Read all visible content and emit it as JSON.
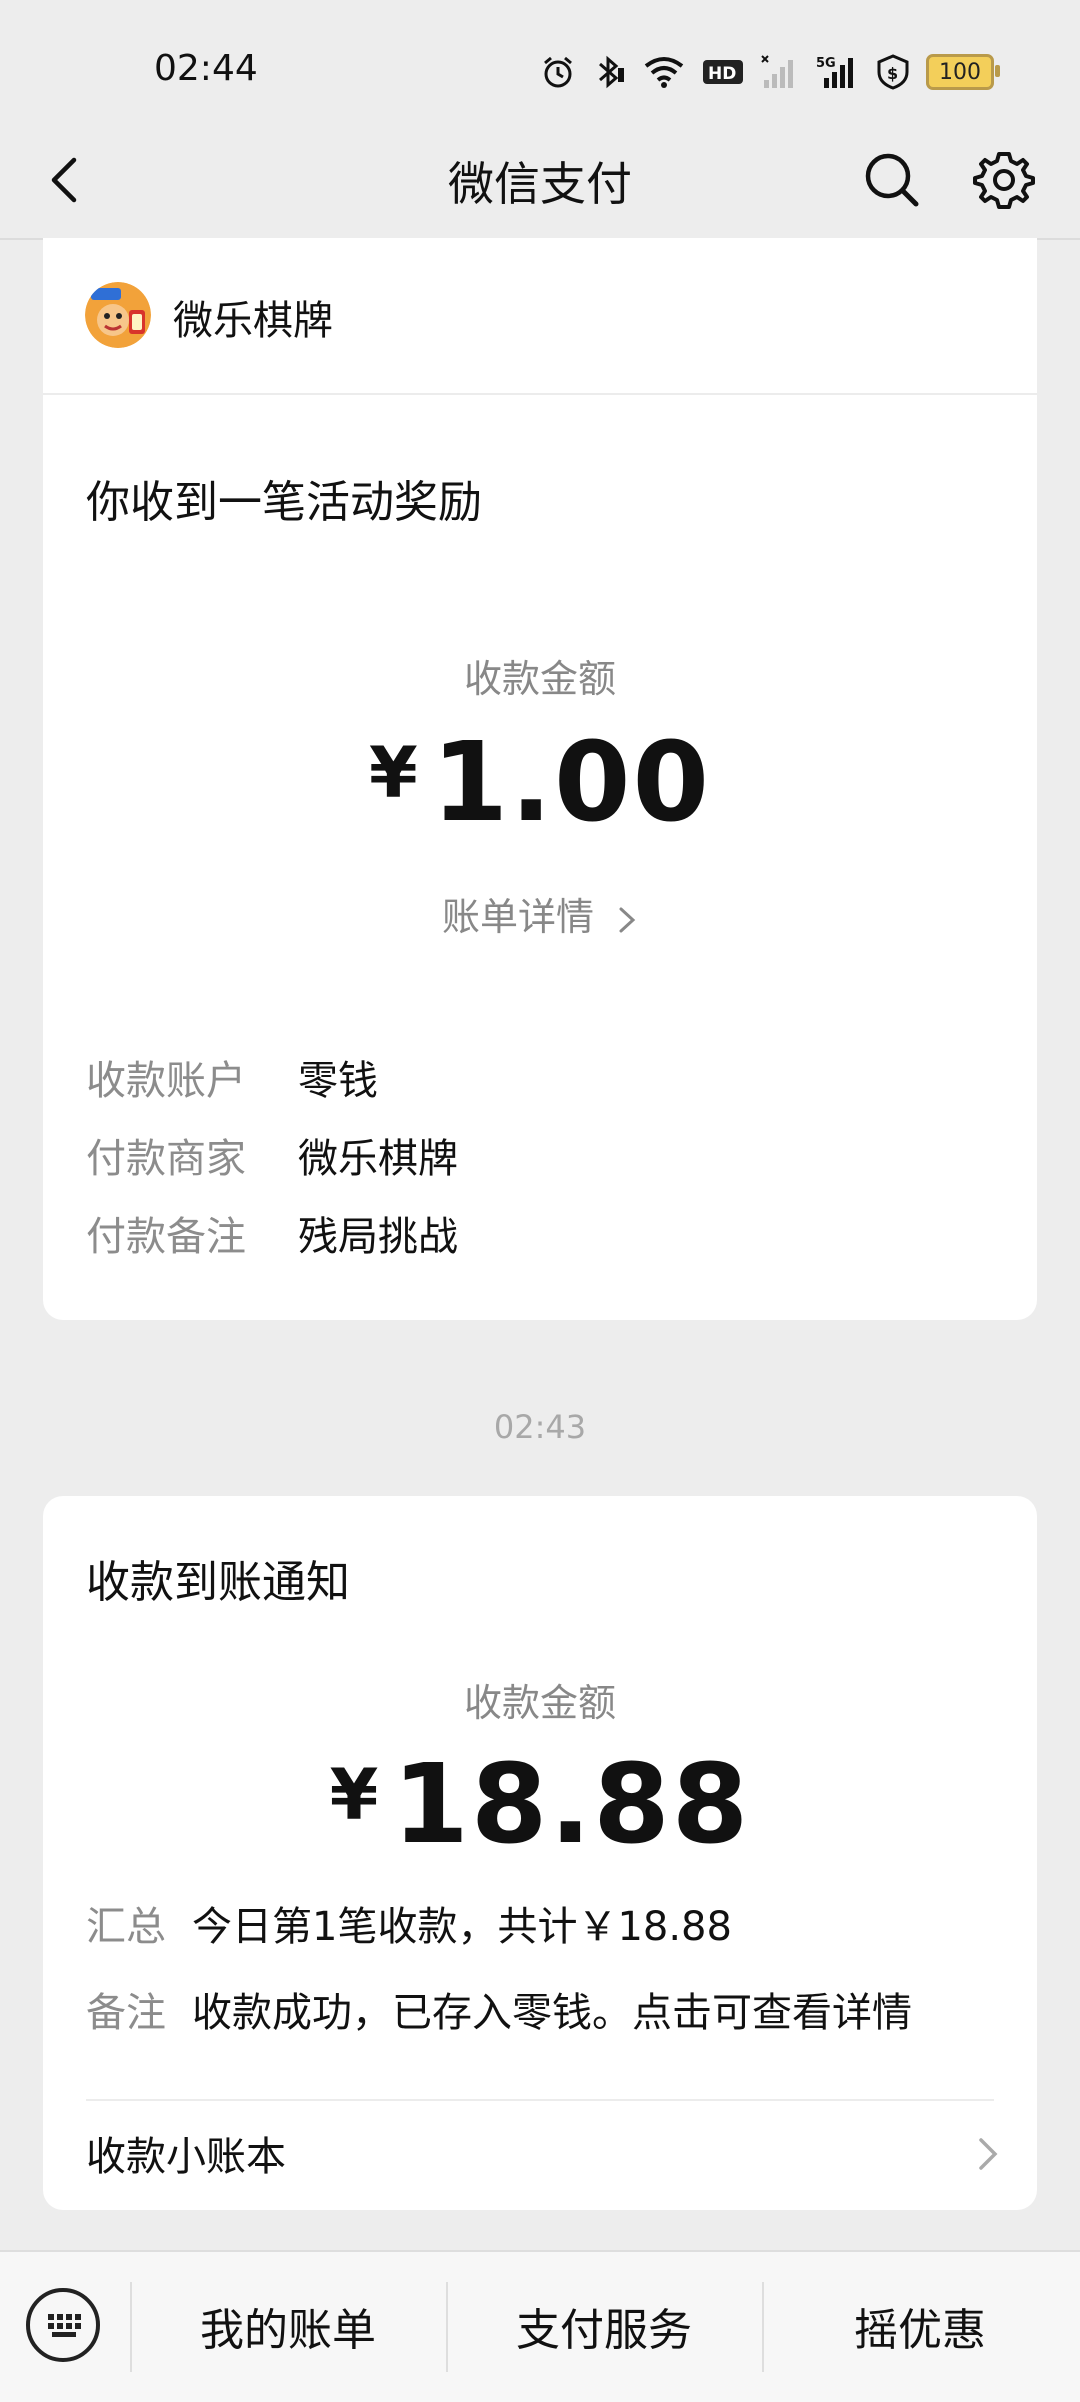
{
  "status_bar": {
    "time": "02:44",
    "network": "5G",
    "hd": "HD",
    "battery": "100"
  },
  "nav": {
    "title": "微信支付"
  },
  "card1": {
    "merchant_name": "微乐棋牌",
    "headline": "你收到一笔活动奖励",
    "amount_label": "收款金额",
    "currency": "¥",
    "amount": "1.00",
    "bill_link": "账单详情",
    "rows": [
      {
        "key": "收款账户",
        "value": "零钱"
      },
      {
        "key": "付款商家",
        "value": "微乐棋牌"
      },
      {
        "key": "付款备注",
        "value": "残局挑战"
      }
    ]
  },
  "timestamp": "02:43",
  "card2": {
    "headline": "收款到账通知",
    "amount_label": "收款金额",
    "currency": "¥",
    "amount": "18.88",
    "rows": [
      {
        "key": "汇总",
        "value": "今日第1笔收款，共计￥18.88"
      },
      {
        "key": "备注",
        "value": "收款成功，已存入零钱。点击可查看详情"
      }
    ],
    "ledger_label": "收款小账本"
  },
  "bottom_bar": {
    "items": [
      "我的账单",
      "支付服务",
      "摇优惠"
    ]
  }
}
